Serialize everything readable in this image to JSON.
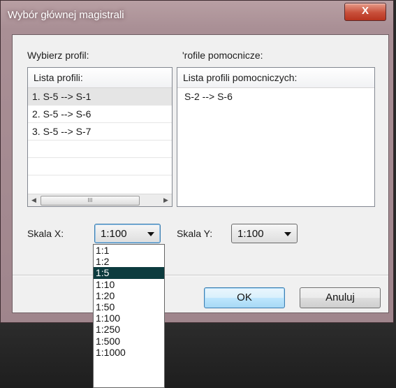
{
  "window": {
    "title": "Wybór głównej magistrali",
    "close_glyph": "X"
  },
  "left_panel": {
    "label": "Wybierz profil:",
    "header": "Lista profili:",
    "items": [
      "1. S-5 --> S-1",
      "2. S-5 --> S-6",
      "3. S-5 --> S-7"
    ],
    "selected_index": 0,
    "scroll_left": "◀",
    "scroll_thumb": "III",
    "scroll_right": "▶"
  },
  "right_panel": {
    "label": "'rofile pomocnicze:",
    "header": "Lista profili pomocniczych:",
    "items": [
      "S-2 --> S-6"
    ]
  },
  "scale_x": {
    "label": "Skala X:",
    "value": "1:100"
  },
  "scale_y": {
    "label": "Skala Y:",
    "value": "1:100"
  },
  "dropdown": {
    "options": [
      "1:1",
      "1:2",
      "1:5",
      "1:10",
      "1:20",
      "1:50",
      "1:100",
      "1:250",
      "1:500",
      "1:1000"
    ],
    "highlighted_index": 2
  },
  "buttons": {
    "ok": "OK",
    "cancel": "Anuluj"
  },
  "colors": {
    "highlight": "#0c3b3e",
    "title_text": "#ffffff",
    "close_button": "#c84f3a"
  }
}
